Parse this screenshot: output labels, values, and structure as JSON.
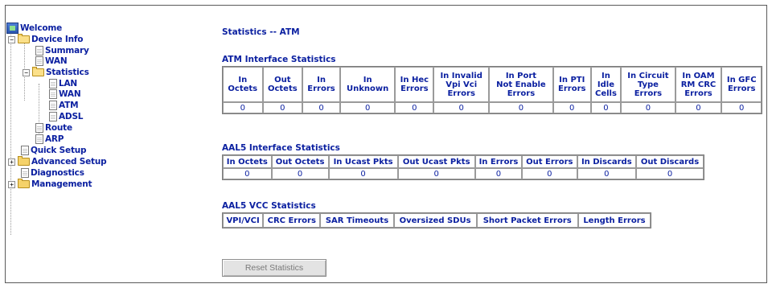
{
  "nav": {
    "welcome": "Welcome",
    "device_info": "Device Info",
    "summary": "Summary",
    "wan": "WAN",
    "statistics": "Statistics",
    "stats_lan": "LAN",
    "stats_wan": "WAN",
    "stats_atm": "ATM",
    "stats_adsl": "ADSL",
    "route": "Route",
    "arp": "ARP",
    "quick_setup": "Quick Setup",
    "advanced_setup": "Advanced Setup",
    "diagnostics": "Diagnostics",
    "management": "Management"
  },
  "page_title": "Statistics -- ATM",
  "atm_interface": {
    "title": "ATM Interface Statistics",
    "headers": [
      [
        "In",
        "Octets"
      ],
      [
        "Out",
        "Octets"
      ],
      [
        "In",
        "Errors"
      ],
      [
        "In",
        "Unknown"
      ],
      [
        "In Hec",
        "Errors"
      ],
      [
        "In Invalid",
        "Vpi Vci",
        "Errors"
      ],
      [
        "In Port",
        "Not Enable",
        "Errors"
      ],
      [
        "In PTI",
        "Errors"
      ],
      [
        "In",
        "Idle",
        "Cells"
      ],
      [
        "In Circuit",
        "Type",
        "Errors"
      ],
      [
        "In OAM",
        "RM CRC",
        "Errors"
      ],
      [
        "In GFC",
        "Errors"
      ]
    ],
    "values": [
      "0",
      "0",
      "0",
      "0",
      "0",
      "0",
      "0",
      "0",
      "0",
      "0",
      "0",
      "0"
    ]
  },
  "aal5_interface": {
    "title": "AAL5 Interface Statistics",
    "headers": [
      "In Octets",
      "Out Octets",
      "In Ucast Pkts",
      "Out Ucast Pkts",
      "In Errors",
      "Out Errors",
      "In Discards",
      "Out Discards"
    ],
    "values": [
      "0",
      "0",
      "0",
      "0",
      "0",
      "0",
      "0",
      "0"
    ]
  },
  "aal5_vcc": {
    "title": "AAL5 VCC Statistics",
    "headers": [
      "VPI/VCI",
      "CRC Errors",
      "SAR Timeouts",
      "Oversized SDUs",
      "Short Packet Errors",
      "Length Errors"
    ]
  },
  "reset_button": "Reset Statistics",
  "colors": {
    "link_text": "#0a1fa0",
    "border": "#9a9a9a",
    "button_bg": "#e3e3e3"
  }
}
